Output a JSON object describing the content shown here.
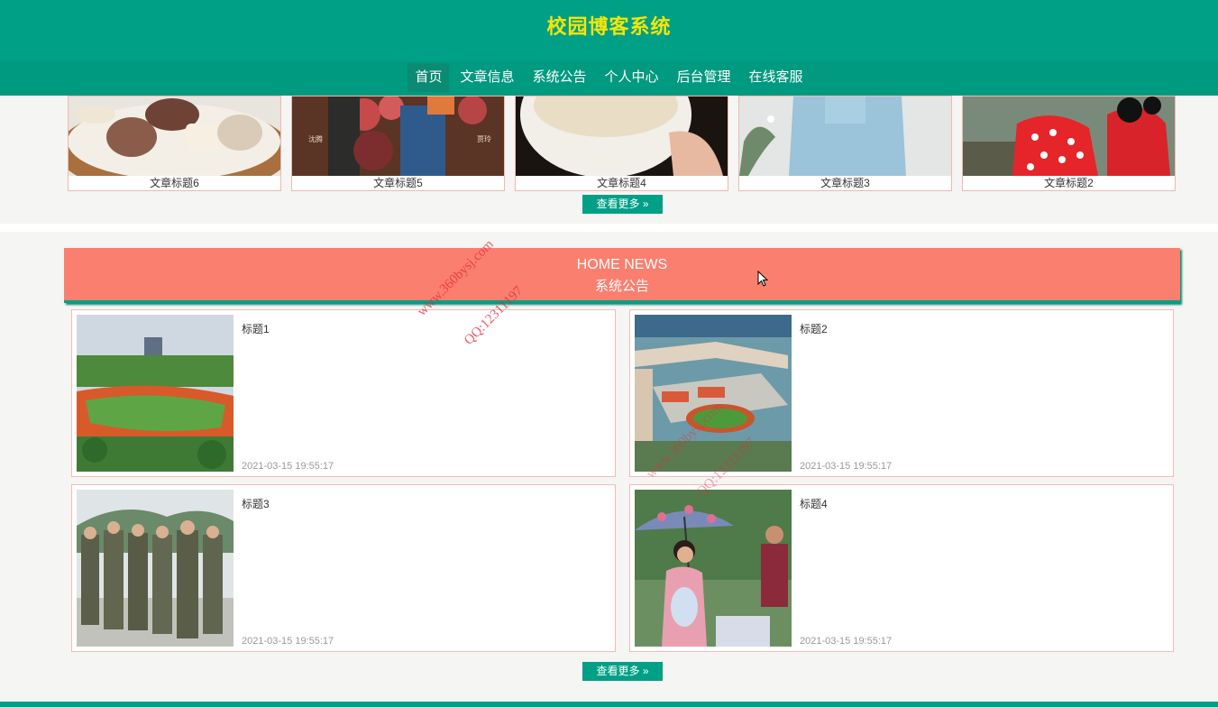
{
  "header": {
    "title": "校园博客系统",
    "nav": [
      {
        "label": "首页",
        "active": true
      },
      {
        "label": "文章信息",
        "active": false
      },
      {
        "label": "系统公告",
        "active": false
      },
      {
        "label": "个人中心",
        "active": false
      },
      {
        "label": "后台管理",
        "active": false
      },
      {
        "label": "在线客服",
        "active": false
      }
    ]
  },
  "articles": [
    {
      "title": "文章标题6",
      "image": "food-bowl-photo"
    },
    {
      "title": "文章标题5",
      "image": "movie-poster-photo"
    },
    {
      "title": "文章标题4",
      "image": "coffee-cup-photo"
    },
    {
      "title": "文章标题3",
      "image": "blue-sweater-photo"
    },
    {
      "title": "文章标题2",
      "image": "minnie-mouse-photo"
    }
  ],
  "more_label": "查看更多",
  "news_section": {
    "title_en": "HOME NEWS",
    "title_cn": "系统公告",
    "items": [
      {
        "title": "标题1",
        "date": "2021-03-15 19:55:17",
        "image": "campus-track-photo"
      },
      {
        "title": "标题2",
        "date": "2021-03-15 19:55:17",
        "image": "school-building-photo"
      },
      {
        "title": "标题3",
        "date": "2021-03-15 19:55:17",
        "image": "military-training-photo"
      },
      {
        "title": "标题4",
        "date": "2021-03-15 19:55:17",
        "image": "umbrella-girl-photo"
      }
    ]
  },
  "watermark": {
    "site": "www.360bysj.com",
    "qq": "QQ:12311197"
  },
  "colors": {
    "primary": "#00a086",
    "title_yellow": "#f5e50a",
    "banner_salmon": "#fa7f6f"
  }
}
